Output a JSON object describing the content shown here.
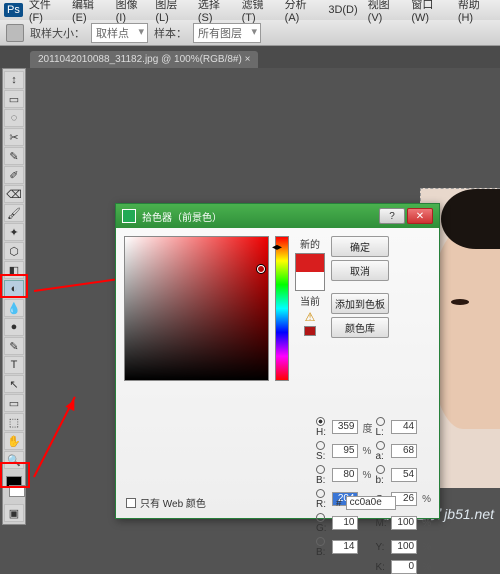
{
  "menu": [
    "文件(F)",
    "编辑(E)",
    "图像(I)",
    "图层(L)",
    "选择(S)",
    "滤镜(T)",
    "分析(A)",
    "3D(D)",
    "视图(V)",
    "窗口(W)",
    "帮助(H)"
  ],
  "options": {
    "sample_size_label": "取样大小：",
    "sample_size_value": "取样点",
    "sample_label": "样本：",
    "sample_value": "所有图层"
  },
  "tab": {
    "title": "2011042010088_31182.jpg @ 100%(RGB/8#) ×",
    "close": "×"
  },
  "toolIcons": [
    "↕",
    "□",
    "◌",
    "✂",
    "✎",
    "✐",
    "⌫",
    "▭",
    "✦",
    "⬡",
    "◧",
    "●",
    "✎",
    "△",
    "T",
    "↖",
    "⬚",
    "✋",
    "🔍",
    "⬚"
  ],
  "dialog": {
    "title": "拾色器（前景色）",
    "new_label": "新的",
    "current_label": "当前",
    "btn_ok": "确定",
    "btn_cancel": "取消",
    "btn_add": "添加到色板",
    "btn_lib": "颜色库",
    "web_only": "只有 Web 颜色",
    "hex_prefix": "#",
    "hex": "cc0a0e",
    "swatch_new": "#d81e1e",
    "swatch_cur": "#ffffff",
    "fields": {
      "H": {
        "v": "359",
        "u": "度"
      },
      "S": {
        "v": "95",
        "u": "%"
      },
      "B": {
        "v": "80",
        "u": "%"
      },
      "R": {
        "v": "204",
        "u": ""
      },
      "G": {
        "v": "10",
        "u": ""
      },
      "Bb": {
        "v": "14",
        "u": ""
      },
      "L": {
        "v": "44",
        "u": ""
      },
      "a": {
        "v": "68",
        "u": ""
      },
      "b": {
        "v": "54",
        "u": ""
      },
      "C": {
        "v": "26",
        "u": "%"
      },
      "M": {
        "v": "100",
        "u": "%"
      },
      "Y": {
        "v": "100",
        "u": "%"
      },
      "K": {
        "v": "0",
        "u": "%"
      }
    }
  },
  "watermark": "脚本之家 jb51.net"
}
